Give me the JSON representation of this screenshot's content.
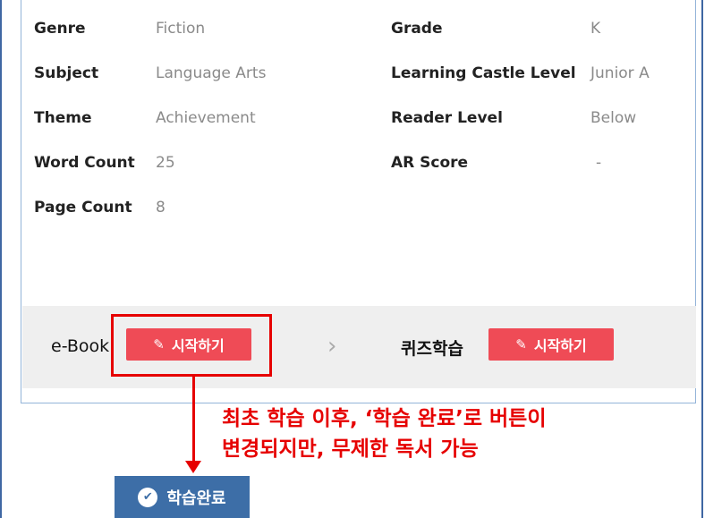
{
  "info": {
    "left": [
      {
        "label": "Genre",
        "value": "Fiction"
      },
      {
        "label": "Subject",
        "value": "Language Arts"
      },
      {
        "label": "Theme",
        "value": "Achievement"
      },
      {
        "label": "Word Count",
        "value": "25"
      },
      {
        "label": "Page Count",
        "value": "8"
      }
    ],
    "right": [
      {
        "label": "Grade",
        "value": "K"
      },
      {
        "label": "Learning Castle Level",
        "value": "Junior A"
      },
      {
        "label": "Reader Level",
        "value": "Below"
      },
      {
        "label": "AR Score",
        "value": "-"
      }
    ]
  },
  "footer": {
    "ebook_label": "e-Book",
    "ebook_start": "시작하기",
    "quiz_label": "퀴즈학습",
    "quiz_start": "시작하기",
    "pen_icon": "pencil-icon",
    "chevron_icon": "chevron-right-icon"
  },
  "annotation": {
    "line1": "최초 학습 이후, ‘학습 완료’로 버튼이",
    "line2": "변경되지만, 무제한 독서 가능",
    "color": "#e60000"
  },
  "done_button": {
    "label": "학습완료",
    "icon": "check-circle-icon",
    "color": "#3d6ea7"
  }
}
